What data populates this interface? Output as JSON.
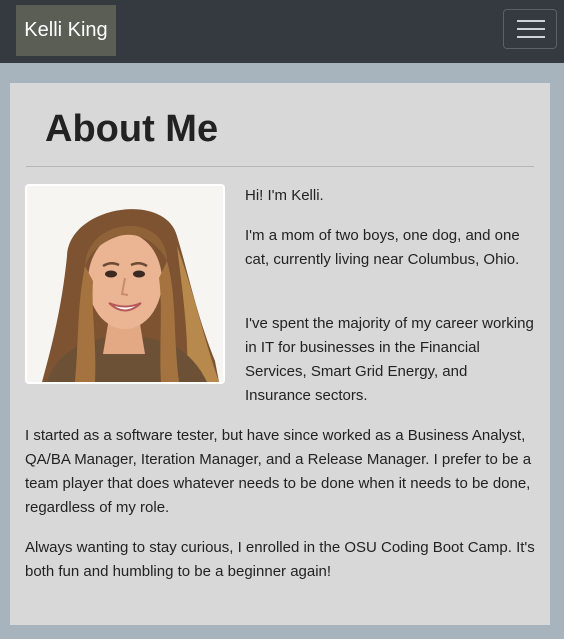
{
  "navbar": {
    "brand": "Kelli King",
    "toggle_icon": "hamburger-menu-icon"
  },
  "about": {
    "title": "About Me",
    "photo_icon": "profile-photo",
    "paragraphs": [
      "Hi! I'm Kelli.",
      "I'm a mom of two boys, one dog, and one cat, currently living near Columbus, Ohio.",
      "I've spent the majority of my career working in IT for businesses in the Financial Services, Smart Grid Energy, and Insurance sectors.",
      "I started as a software tester, but have since worked as a Business Analyst, QA/BA Manager, Iteration Manager, and a Release Manager. I prefer to be a team player that does whatever needs to be done when it needs to be done, regardless of my role.",
      "Always wanting to stay curious, I enrolled in the OSU Coding Boot Camp. It's both fun and humbling to be a beginner again!"
    ]
  },
  "colors": {
    "navbar": "#343a40",
    "page_bg": "#a7b4bd",
    "card_bg": "#d8d8d8",
    "text": "#222222"
  }
}
